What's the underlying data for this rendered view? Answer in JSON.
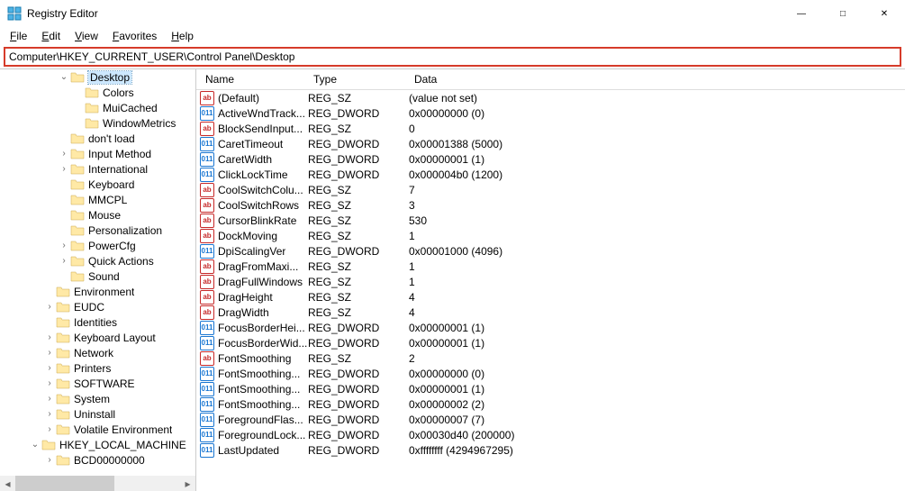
{
  "window": {
    "title": "Registry Editor"
  },
  "menu": {
    "file": "File",
    "edit": "Edit",
    "view": "View",
    "favorites": "Favorites",
    "help": "Help"
  },
  "address": "Computer\\HKEY_CURRENT_USER\\Control Panel\\Desktop",
  "columns": {
    "name": "Name",
    "type": "Type",
    "data": "Data"
  },
  "tree": [
    {
      "label": "Desktop",
      "depth": 4,
      "expander": "v",
      "selected": true
    },
    {
      "label": "Colors",
      "depth": 5,
      "expander": ""
    },
    {
      "label": "MuiCached",
      "depth": 5,
      "expander": ""
    },
    {
      "label": "WindowMetrics",
      "depth": 5,
      "expander": ""
    },
    {
      "label": "don't load",
      "depth": 4,
      "expander": ""
    },
    {
      "label": "Input Method",
      "depth": 4,
      "expander": ">"
    },
    {
      "label": "International",
      "depth": 4,
      "expander": ">"
    },
    {
      "label": "Keyboard",
      "depth": 4,
      "expander": ""
    },
    {
      "label": "MMCPL",
      "depth": 4,
      "expander": ""
    },
    {
      "label": "Mouse",
      "depth": 4,
      "expander": ""
    },
    {
      "label": "Personalization",
      "depth": 4,
      "expander": ""
    },
    {
      "label": "PowerCfg",
      "depth": 4,
      "expander": ">"
    },
    {
      "label": "Quick Actions",
      "depth": 4,
      "expander": ">"
    },
    {
      "label": "Sound",
      "depth": 4,
      "expander": ""
    },
    {
      "label": "Environment",
      "depth": 3,
      "expander": ""
    },
    {
      "label": "EUDC",
      "depth": 3,
      "expander": ">"
    },
    {
      "label": "Identities",
      "depth": 3,
      "expander": ""
    },
    {
      "label": "Keyboard Layout",
      "depth": 3,
      "expander": ">"
    },
    {
      "label": "Network",
      "depth": 3,
      "expander": ">"
    },
    {
      "label": "Printers",
      "depth": 3,
      "expander": ">"
    },
    {
      "label": "SOFTWARE",
      "depth": 3,
      "expander": ">"
    },
    {
      "label": "System",
      "depth": 3,
      "expander": ">"
    },
    {
      "label": "Uninstall",
      "depth": 3,
      "expander": ">"
    },
    {
      "label": "Volatile Environment",
      "depth": 3,
      "expander": ">"
    },
    {
      "label": "HKEY_LOCAL_MACHINE",
      "depth": 2,
      "expander": "v"
    },
    {
      "label": "BCD00000000",
      "depth": 3,
      "expander": ">"
    }
  ],
  "values": [
    {
      "name": "(Default)",
      "type": "REG_SZ",
      "data": "(value not set)",
      "icon": "sz"
    },
    {
      "name": "ActiveWndTrack...",
      "type": "REG_DWORD",
      "data": "0x00000000 (0)",
      "icon": "dw"
    },
    {
      "name": "BlockSendInput...",
      "type": "REG_SZ",
      "data": "0",
      "icon": "sz"
    },
    {
      "name": "CaretTimeout",
      "type": "REG_DWORD",
      "data": "0x00001388 (5000)",
      "icon": "dw"
    },
    {
      "name": "CaretWidth",
      "type": "REG_DWORD",
      "data": "0x00000001 (1)",
      "icon": "dw"
    },
    {
      "name": "ClickLockTime",
      "type": "REG_DWORD",
      "data": "0x000004b0 (1200)",
      "icon": "dw"
    },
    {
      "name": "CoolSwitchColu...",
      "type": "REG_SZ",
      "data": "7",
      "icon": "sz"
    },
    {
      "name": "CoolSwitchRows",
      "type": "REG_SZ",
      "data": "3",
      "icon": "sz"
    },
    {
      "name": "CursorBlinkRate",
      "type": "REG_SZ",
      "data": "530",
      "icon": "sz"
    },
    {
      "name": "DockMoving",
      "type": "REG_SZ",
      "data": "1",
      "icon": "sz"
    },
    {
      "name": "DpiScalingVer",
      "type": "REG_DWORD",
      "data": "0x00001000 (4096)",
      "icon": "dw"
    },
    {
      "name": "DragFromMaxi...",
      "type": "REG_SZ",
      "data": "1",
      "icon": "sz"
    },
    {
      "name": "DragFullWindows",
      "type": "REG_SZ",
      "data": "1",
      "icon": "sz"
    },
    {
      "name": "DragHeight",
      "type": "REG_SZ",
      "data": "4",
      "icon": "sz"
    },
    {
      "name": "DragWidth",
      "type": "REG_SZ",
      "data": "4",
      "icon": "sz"
    },
    {
      "name": "FocusBorderHei...",
      "type": "REG_DWORD",
      "data": "0x00000001 (1)",
      "icon": "dw"
    },
    {
      "name": "FocusBorderWid...",
      "type": "REG_DWORD",
      "data": "0x00000001 (1)",
      "icon": "dw"
    },
    {
      "name": "FontSmoothing",
      "type": "REG_SZ",
      "data": "2",
      "icon": "sz"
    },
    {
      "name": "FontSmoothing...",
      "type": "REG_DWORD",
      "data": "0x00000000 (0)",
      "icon": "dw"
    },
    {
      "name": "FontSmoothing...",
      "type": "REG_DWORD",
      "data": "0x00000001 (1)",
      "icon": "dw"
    },
    {
      "name": "FontSmoothing...",
      "type": "REG_DWORD",
      "data": "0x00000002 (2)",
      "icon": "dw"
    },
    {
      "name": "ForegroundFlas...",
      "type": "REG_DWORD",
      "data": "0x00000007 (7)",
      "icon": "dw"
    },
    {
      "name": "ForegroundLock...",
      "type": "REG_DWORD",
      "data": "0x00030d40 (200000)",
      "icon": "dw"
    },
    {
      "name": "LastUpdated",
      "type": "REG_DWORD",
      "data": "0xffffffff (4294967295)",
      "icon": "dw"
    }
  ]
}
